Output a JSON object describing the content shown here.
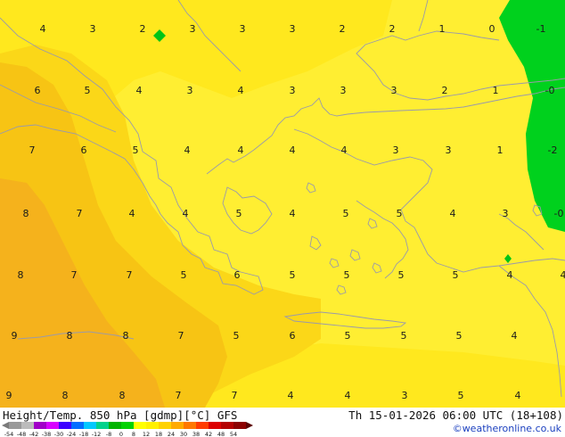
{
  "map": {
    "title": "Height/Temp. 850 hPa [gdmp][°C] GFS",
    "valid_time": "Th 15-01-2026 06:00 UTC (18+108)",
    "credit": "©weatheronline.co.uk",
    "colors": {
      "zone_ge_8": "#f5b21c",
      "zone_6_8": "#f7c414",
      "zone_4_6": "#fbd718",
      "zone_2_4": "#ffe81e",
      "zone_0_2": "#ffee32",
      "zone_neg": "#00d11d",
      "coastline": "#9a9aaa"
    },
    "values": [
      [
        "4",
        "3",
        "2",
        "3",
        "3",
        "3",
        "2",
        "2",
        "1",
        "0",
        "-1"
      ],
      [
        "6",
        "5",
        "4",
        "3",
        "4",
        "3",
        "3",
        "3",
        "2",
        "1",
        "-0"
      ],
      [
        "7",
        "6",
        "5",
        "4",
        "4",
        "4",
        "4",
        "3",
        "3",
        "1",
        "-2"
      ],
      [
        "8",
        "7",
        "4",
        "4",
        "5",
        "4",
        "5",
        "5",
        "4",
        "3",
        "-0"
      ],
      [
        "8",
        "7",
        "7",
        "5",
        "6",
        "5",
        "5",
        "5",
        "5",
        "4",
        "4"
      ],
      [
        "9",
        "8",
        "8",
        "7",
        "5",
        "6",
        "5",
        "5",
        "5",
        "4"
      ],
      [
        "9",
        "8",
        "8",
        "7",
        "7",
        "4",
        "4",
        "3",
        "5",
        "4"
      ]
    ],
    "colorbar_labels": [
      "-54",
      "-48",
      "-42",
      "-38",
      "-30",
      "-24",
      "-18",
      "-12",
      "-8",
      "0",
      "8",
      "12",
      "18",
      "24",
      "30",
      "38",
      "42",
      "48",
      "54"
    ]
  }
}
